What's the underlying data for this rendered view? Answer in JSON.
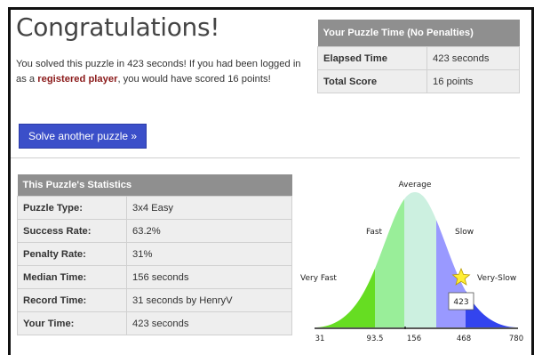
{
  "page": {
    "title": "Congratulations!",
    "message_part1": "You solved this puzzle in 423 seconds! If you had been logged in as a ",
    "message_link": "registered player",
    "message_part2": ", you would have scored 16 points!"
  },
  "time_table": {
    "header": "Your Puzzle Time (No Penalties)",
    "rows": [
      {
        "label": "Elapsed Time",
        "value": "423 seconds"
      },
      {
        "label": "Total Score",
        "value": "16 points"
      }
    ]
  },
  "solve_button": "Solve another puzzle »",
  "stats": {
    "header": "This Puzzle's Statistics",
    "rows": [
      {
        "label": "Puzzle Type:",
        "value": "3x4 Easy"
      },
      {
        "label": "Success Rate:",
        "value": "63.2%"
      },
      {
        "label": "Penalty Rate:",
        "value": "31%"
      },
      {
        "label": "Median Time:",
        "value": "156 seconds"
      },
      {
        "label": "Record Time:",
        "value": "31 seconds by HenryV"
      },
      {
        "label": "Your Time:",
        "value": "423 seconds"
      }
    ]
  },
  "distribution": {
    "labels": {
      "average": "Average",
      "fast": "Fast",
      "slow": "Slow",
      "very_fast": "Very Fast",
      "very_slow": "Very-Slow"
    },
    "ticks": [
      "31",
      "93.5",
      "156",
      "468",
      "780"
    ],
    "marker_value": "423",
    "colors": {
      "very_fast": "#66dd22",
      "fast": "#99ee99",
      "average": "#ccf0e0",
      "slow": "#9999ff",
      "very_slow": "#3344ee",
      "star": "#ffee33"
    }
  }
}
